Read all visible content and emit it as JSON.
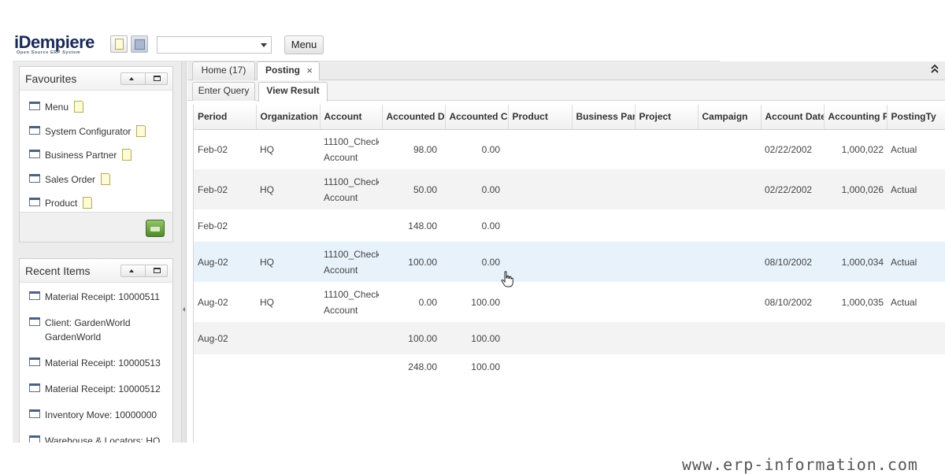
{
  "app": {
    "logo_text": "iDempiere",
    "logo_subtitle": "Open Source ERP System",
    "menu_button": "Menu"
  },
  "favourites": {
    "title": "Favourites",
    "items": [
      "Menu",
      "System Configurator",
      "Business Partner",
      "Sales Order",
      "Product"
    ]
  },
  "recent": {
    "title": "Recent Items",
    "items": [
      "Material Receipt: 10000511",
      "Client: GardenWorld GardenWorld",
      "Material Receipt: 10000513",
      "Material Receipt: 10000512",
      "Inventory Move: 10000000",
      "Warehouse & Locators: HQ HQ Warehouse"
    ]
  },
  "tabs": {
    "home": "Home (17)",
    "posting": "Posting",
    "close_glyph": "×",
    "collapse_glyph": "⌃"
  },
  "subtabs": {
    "query": "Enter Query",
    "result": "View Result"
  },
  "grid": {
    "columns": [
      "Period",
      "Organization",
      "Account",
      "Accounted D",
      "Accounted C",
      "Product",
      "Business Par",
      "Project",
      "Campaign",
      "Account Date",
      "Accounting F",
      "PostingTy"
    ],
    "rows": [
      {
        "period": "Feb-02",
        "org": "HQ",
        "account_line1": "11100_Check",
        "account_line2": "Account",
        "debit": "98.00",
        "credit": "0.00",
        "account_date": "02/22/2002",
        "fact": "1,000,022",
        "posting_type": "Actual"
      },
      {
        "period": "Feb-02",
        "org": "HQ",
        "account_line1": "11100_Check",
        "account_line2": "Account",
        "debit": "50.00",
        "credit": "0.00",
        "account_date": "02/22/2002",
        "fact": "1,000,026",
        "posting_type": "Actual"
      },
      {
        "period": "Feb-02",
        "debit": "148.00",
        "credit": "0.00"
      },
      {
        "period": "Aug-02",
        "org": "HQ",
        "account_line1": "11100_Check",
        "account_line2": "Account",
        "debit": "100.00",
        "credit": "0.00",
        "account_date": "08/10/2002",
        "fact": "1,000,034",
        "posting_type": "Actual"
      },
      {
        "period": "Aug-02",
        "org": "HQ",
        "account_line1": "11100_Check",
        "account_line2": "Account",
        "debit": "0.00",
        "credit": "100.00",
        "account_date": "08/10/2002",
        "fact": "1,000,035",
        "posting_type": "Actual"
      },
      {
        "period": "Aug-02",
        "debit": "100.00",
        "credit": "100.00"
      },
      {
        "debit": "248.00",
        "credit": "100.00"
      }
    ]
  },
  "watermark": "www.erp-information.com"
}
